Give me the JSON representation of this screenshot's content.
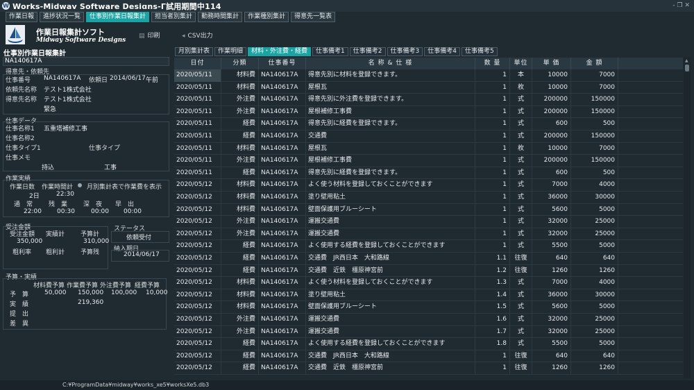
{
  "window": {
    "title": "Works-Midwav Software Desiɑns-Γ試用期間中114",
    "controls": "- ❐ ✕"
  },
  "menu": [
    "作業日報",
    "進捗状況一覧",
    "仕事別作業日報集計",
    "担当者別集計",
    "勤務時間集計",
    "作業種別集計",
    "得意先一覧表"
  ],
  "menu_active": 2,
  "brand": {
    "name": "作業日報集計ソフト",
    "sub": "Midway Software Designs"
  },
  "toolbar": {
    "print": "印刷",
    "csv": "CSV出力"
  },
  "left": {
    "title": "仕事別作業日報集計",
    "order_no": "NA140617A",
    "customer": {
      "header": "得意先・依頼先",
      "work_no_label": "仕事番号",
      "work_no": "NA140617A",
      "request_date_label": "依頼日",
      "request_date": "2014/06/17",
      "request_time": "午前",
      "requester_label": "依頼先名称",
      "requester": "テスト1株式会社",
      "client_label": "得意先名称",
      "client": "テスト1株式会社",
      "urgency": "緊急"
    },
    "work": {
      "header": "仕事データ",
      "name1_label": "仕事名称1",
      "name1": "五重塔補修工事",
      "name2_label": "仕事名称2",
      "type1_label": "仕事タイプ1",
      "type_label": "仕事タイプ",
      "memo_label": "仕事メモ",
      "memo1": "持込",
      "memo2": "工事"
    },
    "actual": {
      "header": "作業実績",
      "days_label": "作業日数",
      "days": "2日",
      "hours_label": "作業時間計",
      "hours": "22:30",
      "monthly_option": "月別集計表で作業費を表示",
      "normal_label": "通　常",
      "normal": "22:00",
      "overtime_label": "残　業",
      "overtime": "00:30",
      "night_label": "深　夜",
      "night": "00:00",
      "outing_label": "早　出",
      "outing": "00:00"
    },
    "order": {
      "header": "受注金額",
      "amount_label": "受注金額",
      "amount": "350,000",
      "actual_label": "実績計",
      "budget_label": "予算計",
      "budget": "310,000",
      "gross_rate_label": "粗利率",
      "gross_label": "粗利計",
      "remaining_label": "予算残"
    },
    "status": {
      "header": "ステータス",
      "value": "依頼受付"
    },
    "delivery": {
      "header": "納入期日",
      "value": "2014/06/17"
    },
    "budget_table": {
      "header": "予算・実績",
      "cols": [
        "材料費予算",
        "作業費予算",
        "外注費予算",
        "経費予算"
      ],
      "rows": [
        {
          "label": "予　算",
          "values": [
            "50,000",
            "150,000",
            "100,000",
            "10,000"
          ]
        },
        {
          "label": "実　績",
          "values": [
            "",
            "219,360",
            "",
            ""
          ]
        },
        {
          "label": "提　出",
          "values": [
            "",
            "",
            "",
            ""
          ]
        },
        {
          "label": "差　異",
          "values": [
            "",
            "",
            "",
            ""
          ]
        }
      ]
    }
  },
  "tabs": [
    "月別集計表",
    "作業明細",
    "材料・外注費・経費",
    "仕事備考1",
    "仕事備考2",
    "仕事備考3",
    "仕事備考4",
    "仕事備考5"
  ],
  "tab_active": 2,
  "table": {
    "columns": [
      "日付",
      "分類",
      "仕事番号",
      "名 称 & 仕 様",
      "数 量",
      "単位",
      "単 価",
      "金 額"
    ],
    "rows": [
      [
        "2020/05/11",
        "材料費",
        "NA140617A",
        "得意先別に材料を登録できます。",
        "1",
        "本",
        "10000",
        "7000"
      ],
      [
        "2020/05/11",
        "材料費",
        "NA140617A",
        "屋根瓦",
        "1",
        "枚",
        "10000",
        "7000"
      ],
      [
        "2020/05/11",
        "外注費",
        "NA140617A",
        "得意先別に外注費を登録できます。",
        "1",
        "式",
        "200000",
        "150000"
      ],
      [
        "2020/05/11",
        "外注費",
        "NA140617A",
        "屋根補修工事費",
        "1",
        "式",
        "200000",
        "150000"
      ],
      [
        "2020/05/11",
        "経費",
        "NA140617A",
        "得意先別に経費を登録できます。",
        "1",
        "式",
        "600",
        "500"
      ],
      [
        "2020/05/11",
        "経費",
        "NA140617A",
        "交通費",
        "1",
        "式",
        "200000",
        "150000"
      ],
      [
        "2020/05/11",
        "材料費",
        "NA140617A",
        "屋根瓦",
        "1",
        "枚",
        "10000",
        "7000"
      ],
      [
        "2020/05/11",
        "外注費",
        "NA140617A",
        "屋根補修工事費",
        "1",
        "式",
        "200000",
        "150000"
      ],
      [
        "2020/05/11",
        "経費",
        "NA140617A",
        "得意先別に経費を登録できます。",
        "1",
        "式",
        "600",
        "500"
      ],
      [
        "2020/05/12",
        "材料費",
        "NA140617A",
        "よく使う材料を登録しておくことができます",
        "1",
        "式",
        "7000",
        "4000"
      ],
      [
        "2020/05/12",
        "材料費",
        "NA140617A",
        "塗り壁用粘土",
        "1",
        "式",
        "36000",
        "30000"
      ],
      [
        "2020/05/12",
        "材料費",
        "NA140617A",
        "壁面保護用ブルーシート",
        "1",
        "式",
        "5600",
        "5000"
      ],
      [
        "2020/05/12",
        "外注費",
        "NA140617A",
        "運搬交通費",
        "1",
        "式",
        "32000",
        "25000"
      ],
      [
        "2020/05/12",
        "外注費",
        "NA140617A",
        "運搬交通費",
        "1",
        "式",
        "32000",
        "25000"
      ],
      [
        "2020/05/12",
        "経費",
        "NA140617A",
        "よく使用する経費を登録しておくことができます",
        "1",
        "式",
        "5500",
        "5000"
      ],
      [
        "2020/05/12",
        "経費",
        "NA140617A",
        "交通費　JR西日本　大和路線",
        "1.1",
        "往復",
        "640",
        "640"
      ],
      [
        "2020/05/12",
        "経費",
        "NA140617A",
        "交通費　近鉄　橿原神宮前",
        "1.2",
        "往復",
        "1260",
        "1260"
      ],
      [
        "2020/05/12",
        "材料費",
        "NA140617A",
        "よく使う材料を登録しておくことができます",
        "1.3",
        "式",
        "7000",
        "4000"
      ],
      [
        "2020/05/12",
        "材料費",
        "NA140617A",
        "塗り壁用粘土",
        "1.4",
        "式",
        "36000",
        "30000"
      ],
      [
        "2020/05/12",
        "材料費",
        "NA140617A",
        "壁面保護用ブルーシート",
        "1.5",
        "式",
        "5600",
        "5000"
      ],
      [
        "2020/05/12",
        "外注費",
        "NA140617A",
        "運搬交通費",
        "1.6",
        "式",
        "32000",
        "25000"
      ],
      [
        "2020/05/12",
        "外注費",
        "NA140617A",
        "運搬交通費",
        "1.7",
        "式",
        "32000",
        "25000"
      ],
      [
        "2020/05/12",
        "経費",
        "NA140617A",
        "よく使用する経費を登録しておくことができます",
        "1.8",
        "式",
        "5500",
        "5000"
      ],
      [
        "2020/05/12",
        "経費",
        "NA140617A",
        "交通費　JR西日本　大和路線",
        "1",
        "往復",
        "640",
        "640"
      ],
      [
        "2020/05/12",
        "経費",
        "NA140617A",
        "交通費　近鉄　橿原神宮前",
        "1",
        "往復",
        "1260",
        "1260"
      ]
    ]
  },
  "status_path": "C:¥ProgramData¥midway¥works_xe5¥worksXe5.db3",
  "colors": {
    "accent": "#1ba3a3",
    "background": "#1f2a31",
    "panel": "#26333b"
  }
}
